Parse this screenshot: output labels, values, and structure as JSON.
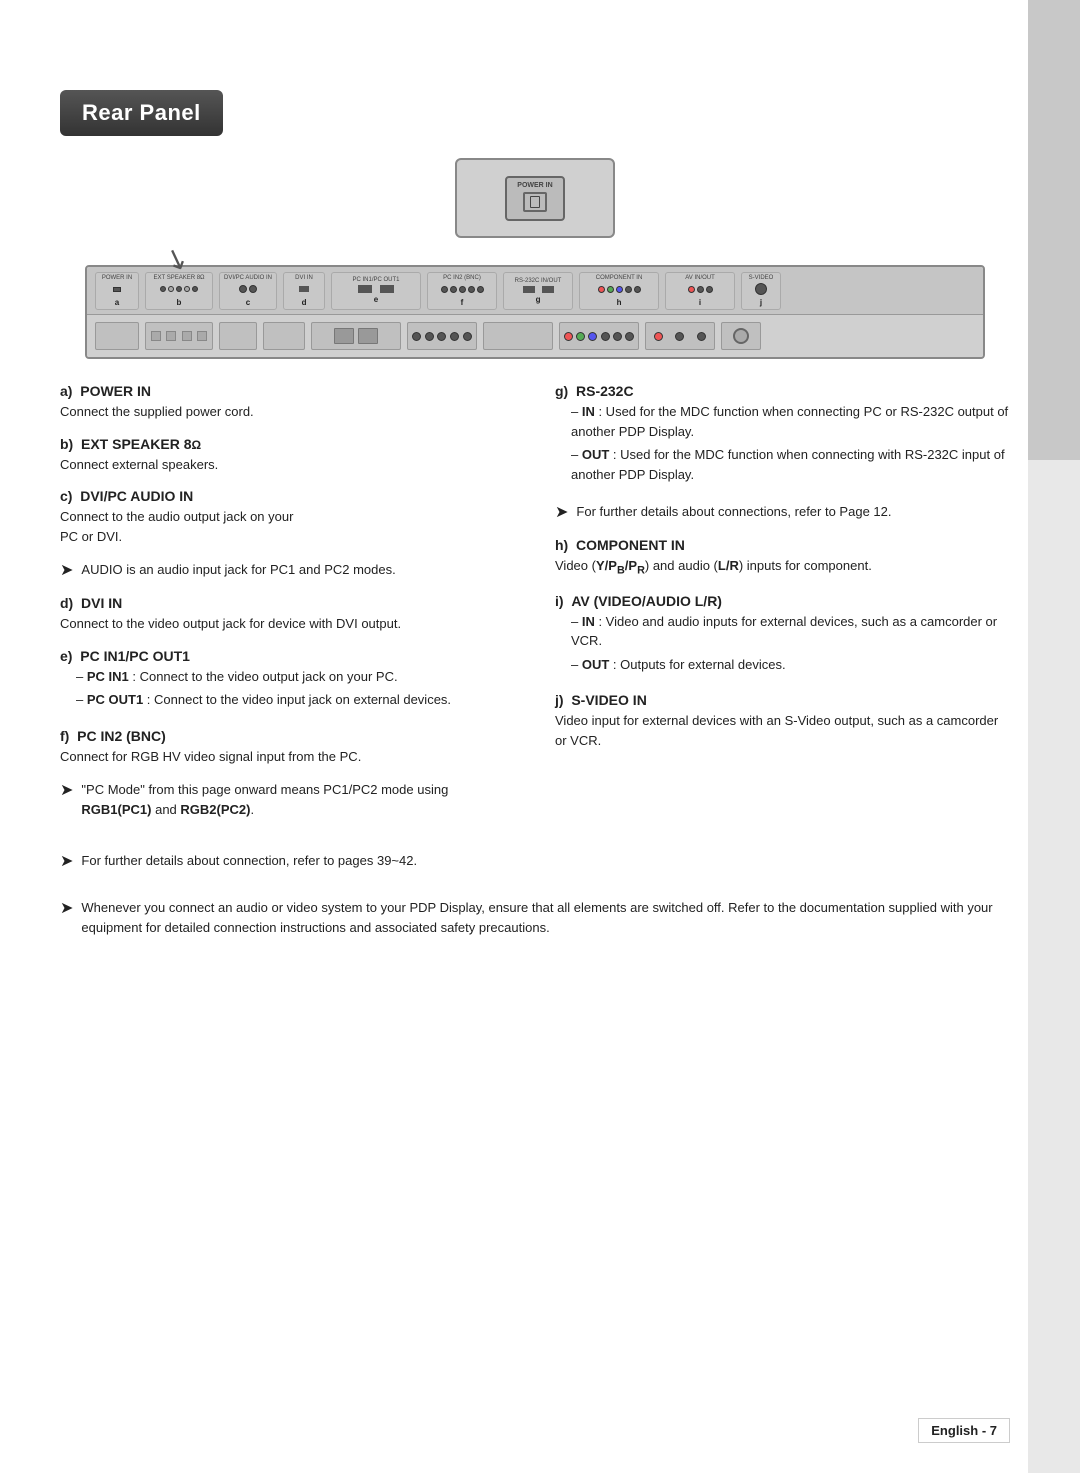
{
  "page": {
    "title": "Rear Panel",
    "footer": "English - 7"
  },
  "sections": {
    "left": [
      {
        "id": "a",
        "header": "a)  POWER IN",
        "lines": [
          "Connect the supplied power cord."
        ]
      },
      {
        "id": "b",
        "header": "b)  EXT SPEAKER 8Ω",
        "lines": [
          "Connect external speakers."
        ]
      },
      {
        "id": "c",
        "header": "c)  DVI/PC AUDIO IN",
        "lines": [
          "Connect to the audio output jack on your",
          "PC or DVI."
        ]
      },
      {
        "id": "c_note",
        "type": "arrow_note",
        "text": "AUDIO is an audio input jack for PC1 and PC2 modes."
      },
      {
        "id": "d",
        "header": "d)  DVI IN",
        "lines": [
          "Connect to the video output jack for device with",
          "DVI output."
        ]
      },
      {
        "id": "e",
        "header": "e)  PC IN1/PC OUT1",
        "dash_items": [
          "– PC IN1 : Connect to the video output jack on your PC.",
          "– PC OUT1 : Connect to the video input jack on external devices."
        ]
      },
      {
        "id": "f",
        "header": "f)  PC IN2 (BNC)",
        "lines": [
          "Connect for RGB HV video signal input from the PC."
        ]
      },
      {
        "id": "f_note",
        "type": "arrow_note",
        "text_bold_parts": [
          "\"PC Mode\" from this page onward means PC1/PC2 mode using ",
          "RGB1(PC1)",
          " and ",
          "RGB2(PC2)",
          "."
        ]
      }
    ],
    "right": [
      {
        "id": "g",
        "header": "g)  RS-232C",
        "dash_items": [
          "– IN : Used for the MDC function when connecting PC or RS-232C output of another PDP Display.",
          "– OUT : Used for the MDC function when connecting with RS-232C input of another PDP Display."
        ]
      },
      {
        "id": "g_note",
        "type": "arrow_note",
        "text": "For further details about connections, refer to Page 12."
      },
      {
        "id": "h",
        "header": "h)  COMPONENT IN",
        "lines": [
          "Video (Y/PB/PR) and audio (L/R) inputs for component."
        ]
      },
      {
        "id": "i",
        "header": "i)  AV (VIDEO/AUDIO L/R)",
        "dash_items": [
          "– IN : Video and audio inputs for external devices, such as a camcorder or VCR.",
          "– OUT : Outputs for external devices."
        ]
      },
      {
        "id": "j",
        "header": "j)  S-VIDEO IN",
        "lines": [
          "Video input for external devices with an S-Video output, such as a camcorder or VCR."
        ]
      }
    ]
  },
  "bottom_notes": [
    "For further details about connection, refer to pages 39~42.",
    "Whenever you connect an audio or video system to your PDP Display, ensure that all elements are switched off. Refer to the documentation supplied with your equipment  for detailed connection instructions and associated safety precautions."
  ],
  "panel": {
    "letters": [
      "a",
      "b",
      "c",
      "d",
      "e",
      "f",
      "g",
      "h",
      "i",
      "j"
    ]
  }
}
